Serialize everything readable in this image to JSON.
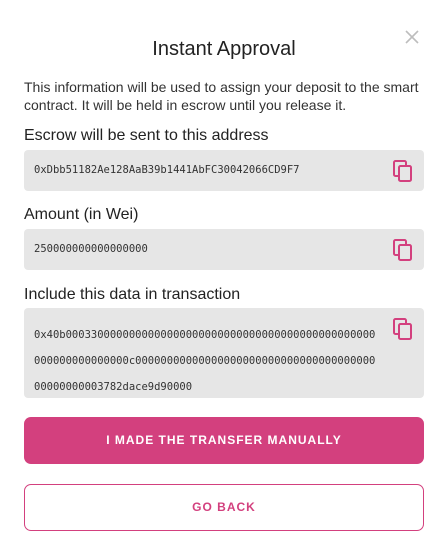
{
  "dialog": {
    "title": "Instant Approval",
    "description": "This information will be used to assign your deposit to the smart contract. It will be held in escrow until you release it.",
    "close_icon": "close-icon"
  },
  "fields": {
    "address": {
      "label": "Escrow will be sent to this address",
      "value": "0xDbb51182Ae128AaB39b1441AbFC30042066CD9F7",
      "icon": "copy-icon"
    },
    "amount": {
      "label": "Amount (in Wei)",
      "value": "250000000000000000",
      "icon": "copy-icon"
    },
    "data": {
      "label": "Include this data in transaction",
      "value": "0x40b0003300000000000000000000000000000000000000000000000000000000000c0000000000000000000000000000000000000000000000003782dace9d90000",
      "icon": "copy-icon"
    }
  },
  "actions": {
    "primary_label": "I MADE THE TRANSFER MANUALLY",
    "secondary_label": "GO BACK"
  },
  "colors": {
    "accent": "#d3407e",
    "field_bg": "#e6e6e6",
    "close_icon": "#bdbdbd"
  }
}
